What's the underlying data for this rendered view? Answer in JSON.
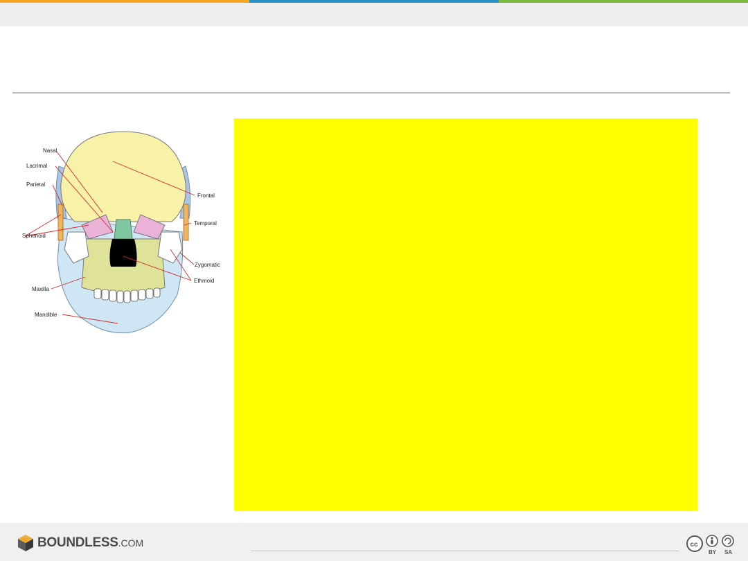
{
  "figure": {
    "labels": {
      "nasal": "Nasal",
      "lacrimal": "Lacrimal",
      "parietal": "Parietal",
      "sphenoid": "Sphenoid",
      "maxilla": "Maxilla",
      "mandible": "Mandible",
      "frontal": "Frontal",
      "temporal": "Temporal",
      "zygomatic": "Zygomatic",
      "ethmoid": "Ethmoid"
    },
    "colors": {
      "frontal": "#f8f1a8",
      "temporal": "#a9c4e4",
      "mandible": "#cfe6f5",
      "maxilla": "#dfe39a",
      "lacrimal": "#e9b2d6",
      "nasal": "#7fc6a1",
      "sphenoid": "#f1b45e",
      "leader": "#d62b2b"
    }
  },
  "footer": {
    "brand": "BOUNDLESS",
    "brand_suffix": ".COM",
    "license_by": "BY",
    "license_sa": "SA",
    "license_cc": "cc"
  }
}
